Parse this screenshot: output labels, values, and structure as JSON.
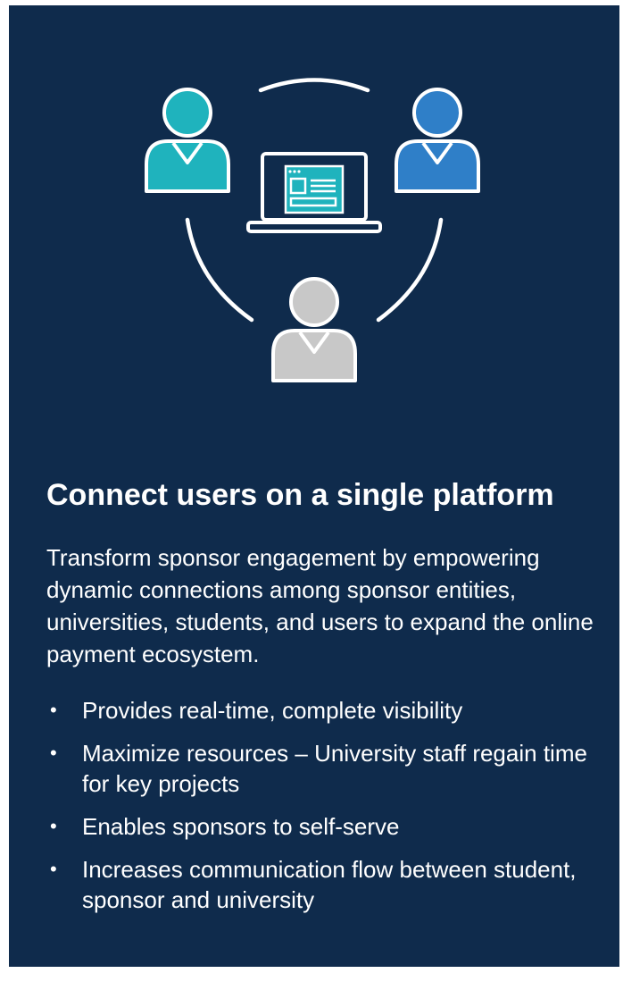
{
  "content": {
    "title": "Connect users on a single platform",
    "description": "Transform sponsor engagement by empowering dynamic connections among sponsor entities, universities, students, and users to expand the online payment ecosystem.",
    "bullets": [
      "Provides real-time, complete visibility",
      "Maximize resources – University staff regain time for key projects",
      "Enables sponsors to self-serve",
      "Increases communication flow between student, sponsor and university"
    ]
  },
  "icons": {
    "left_user": "user-icon",
    "right_user": "user-icon",
    "bottom_user": "user-icon",
    "laptop": "laptop-icon"
  },
  "colors": {
    "background": "#0f2b4c",
    "text": "#ffffff",
    "user_left": "#1fb3bd",
    "user_right": "#2f7fc8",
    "user_bottom": "#c8c8c8",
    "screen": "#1fb3bd"
  }
}
